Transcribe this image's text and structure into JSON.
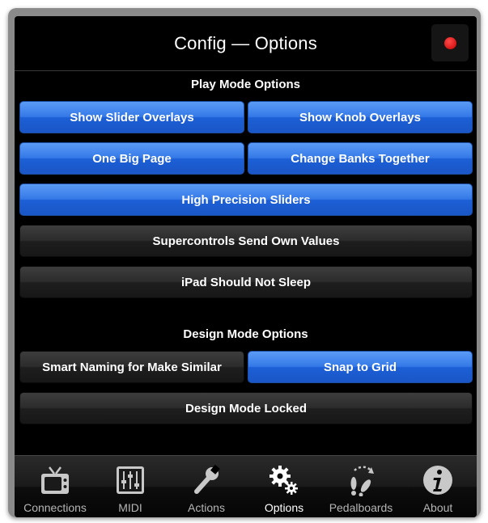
{
  "header": {
    "title": "Config — Options"
  },
  "play_mode": {
    "title": "Play Mode Options",
    "buttons": [
      {
        "label": "Show Slider Overlays",
        "state": "on"
      },
      {
        "label": "Show Knob Overlays",
        "state": "on"
      },
      {
        "label": "One Big Page",
        "state": "on"
      },
      {
        "label": "Change Banks Together",
        "state": "on"
      },
      {
        "label": "High Precision Sliders",
        "state": "on"
      },
      {
        "label": "Supercontrols Send Own Values",
        "state": "off"
      },
      {
        "label": "iPad Should Not Sleep",
        "state": "off"
      }
    ]
  },
  "design_mode": {
    "title": "Design Mode Options",
    "buttons": [
      {
        "label": "Smart Naming for Make Similar",
        "state": "off"
      },
      {
        "label": "Snap to Grid",
        "state": "on"
      },
      {
        "label": "Design Mode Locked",
        "state": "off"
      }
    ]
  },
  "tabbar": {
    "active": "Options",
    "tabs": [
      {
        "label": "Connections",
        "icon": "tv-icon"
      },
      {
        "label": "MIDI",
        "icon": "mixer-icon"
      },
      {
        "label": "Actions",
        "icon": "wrench-icon"
      },
      {
        "label": "Options",
        "icon": "gears-icon"
      },
      {
        "label": "Pedalboards",
        "icon": "footprints-icon"
      },
      {
        "label": "About",
        "icon": "info-icon"
      }
    ]
  },
  "colors": {
    "accent_on": "#3579e8",
    "button_off": "#2c2c2c",
    "record": "#e00000"
  }
}
